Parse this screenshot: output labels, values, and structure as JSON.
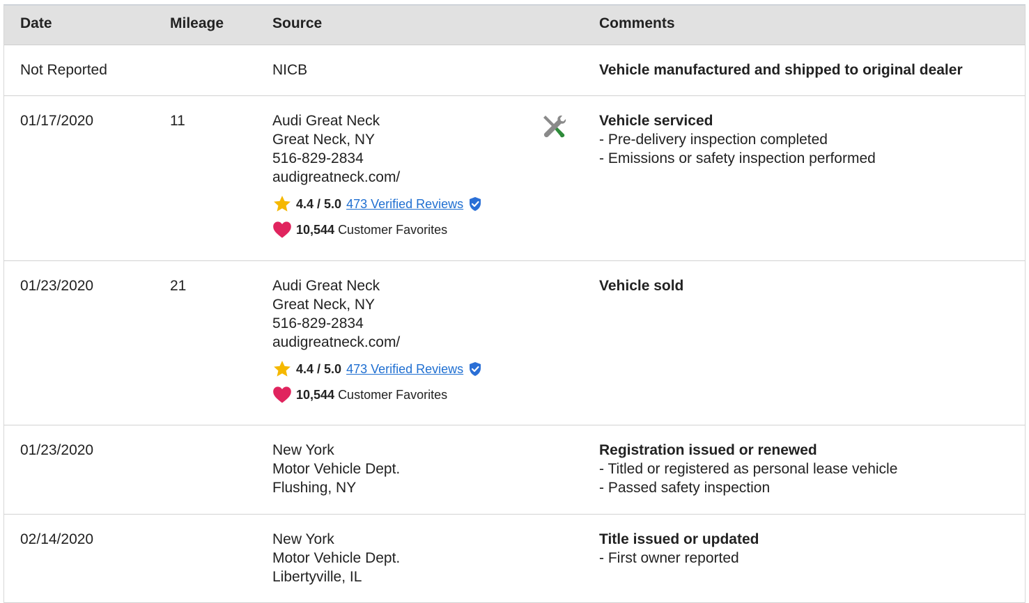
{
  "headers": {
    "date": "Date",
    "mileage": "Mileage",
    "source": "Source",
    "comments": "Comments"
  },
  "rows": [
    {
      "date": "Not Reported",
      "mileage": "",
      "source": [
        "NICB"
      ],
      "comment_title": "Vehicle manufactured and shipped to original dealer",
      "comment_items": []
    },
    {
      "date": "01/17/2020",
      "mileage": "11",
      "source": [
        "Audi Great Neck",
        "Great Neck, NY",
        "516-829-2834",
        "audigreatneck.com/"
      ],
      "rating": "4.4 / 5.0",
      "reviews_link": "473 Verified Reviews",
      "favorites_count": "10,544",
      "favorites_label": "Customer Favorites",
      "icon": "service-tools-icon",
      "comment_title": "Vehicle serviced",
      "comment_items": [
        "- Pre-delivery inspection completed",
        "- Emissions or safety inspection performed"
      ]
    },
    {
      "date": "01/23/2020",
      "mileage": "21",
      "source": [
        "Audi Great Neck",
        "Great Neck, NY",
        "516-829-2834",
        "audigreatneck.com/"
      ],
      "rating": "4.4 / 5.0",
      "reviews_link": "473 Verified Reviews",
      "favorites_count": "10,544",
      "favorites_label": "Customer Favorites",
      "comment_title": "Vehicle sold",
      "comment_items": []
    },
    {
      "date": "01/23/2020",
      "mileage": "",
      "source": [
        "New York",
        "Motor Vehicle Dept.",
        "Flushing, NY"
      ],
      "comment_title": "Registration issued or renewed",
      "comment_items": [
        "- Titled or registered as personal lease vehicle",
        "- Passed safety inspection"
      ]
    },
    {
      "date": "02/14/2020",
      "mileage": "",
      "source": [
        "New York",
        "Motor Vehicle Dept.",
        "Libertyville, IL"
      ],
      "comment_title": "Title issued or updated",
      "comment_items": [
        "- First owner reported"
      ]
    }
  ],
  "colors": {
    "header_bg": "#e1e1e1",
    "link": "#1f6fd1",
    "star": "#f5b800",
    "heart": "#e0245e",
    "verified": "#2a6fd6",
    "tool_green": "#2e8b3a"
  }
}
